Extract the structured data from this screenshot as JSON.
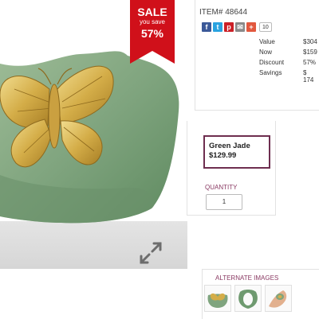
{
  "sale_badge": {
    "word": "SALE",
    "subtext": "you save",
    "percent": "57%",
    "color": "#d0101a"
  },
  "product_image": {
    "alt_icon": "expand-arrows-icon",
    "jade_color": "#7fa47e",
    "gold_color": "#c9a23b"
  },
  "item": {
    "number": "ITEM# 48644"
  },
  "share": {
    "buttons": [
      {
        "icon": "facebook-icon",
        "glyph": "f",
        "color": "#3b5998"
      },
      {
        "icon": "twitter-icon",
        "glyph": "t",
        "color": "#2aa3e0"
      },
      {
        "icon": "pinterest-icon",
        "glyph": "p",
        "color": "#cb2027"
      },
      {
        "icon": "email-icon",
        "glyph": "✉",
        "color": "#8a8a8a"
      },
      {
        "icon": "plus-icon",
        "glyph": "+",
        "color": "#e2583e"
      }
    ],
    "count": "10"
  },
  "pricing": [
    {
      "label": "Value",
      "amount": "$304"
    },
    {
      "label": "Now",
      "amount": "$159"
    },
    {
      "label": "Discount",
      "amount": "57%"
    },
    {
      "label": "Savings",
      "amount": "$ 174"
    }
  ],
  "variant": {
    "name": "Green Jade",
    "price": "$129.99",
    "accent": "#6e2e4f"
  },
  "quantity": {
    "label": "QUANTITY",
    "value": "1"
  },
  "alternate_images": {
    "title": "ALTERNATE IMAGES",
    "thumbs": [
      "butterfly-ring-front",
      "ring-side",
      "ring-on-hand"
    ]
  }
}
